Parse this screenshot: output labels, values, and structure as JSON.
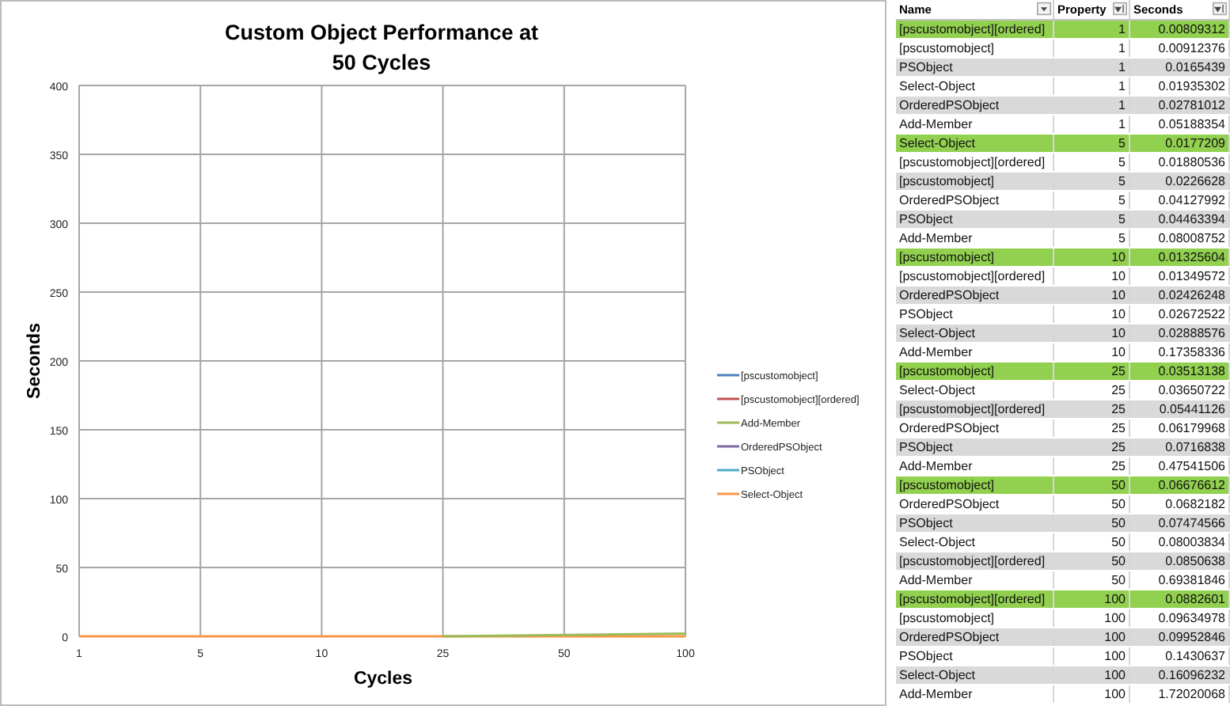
{
  "chart": {
    "chart_data": {
      "type": "line",
      "grid": true,
      "legend": true,
      "title": "Custom Object Performance at 50 Cycles",
      "xlabel": "Cycles",
      "ylabel": "Seconds",
      "categories": [
        "1",
        "5",
        "10",
        "25",
        "50",
        "100"
      ],
      "series": [
        {
          "name": "[pscustomobject]",
          "color": "#4f81bd",
          "values": [
            null,
            null,
            null,
            null,
            null,
            null
          ]
        },
        {
          "name": "[pscustomobject][ordered]",
          "color": "#c0504d",
          "values": [
            null,
            null,
            null,
            null,
            null,
            null
          ]
        },
        {
          "name": "Add-Member",
          "color": "#9bbb59",
          "values": [
            null,
            null,
            null,
            0,
            1,
            2
          ]
        },
        {
          "name": "OrderedPSObject",
          "color": "#8064a2",
          "values": [
            null,
            null,
            null,
            null,
            null,
            null
          ]
        },
        {
          "name": "PSObject",
          "color": "#4bacc6",
          "values": [
            null,
            null,
            null,
            null,
            null,
            null
          ]
        },
        {
          "name": "Select-Object",
          "color": "#f79646",
          "values": [
            0,
            0,
            0,
            0,
            0,
            0
          ]
        }
      ],
      "ylim": [
        0,
        400
      ],
      "yticks": [
        0,
        50,
        100,
        150,
        200,
        250,
        300,
        350,
        400
      ]
    }
  },
  "table": {
    "columns": [
      {
        "label": "Name",
        "kind": "filter"
      },
      {
        "label": "Property",
        "kind": "sort"
      },
      {
        "label": "Seconds",
        "kind": "sort"
      }
    ],
    "rows": [
      {
        "name": "[pscustomobject][ordered]",
        "property": "1",
        "seconds": "0.00809312",
        "highlighted": true
      },
      {
        "name": "[pscustomobject]",
        "property": "1",
        "seconds": "0.00912376",
        "highlighted": false
      },
      {
        "name": "PSObject",
        "property": "1",
        "seconds": "0.0165439",
        "highlighted": false
      },
      {
        "name": "Select-Object",
        "property": "1",
        "seconds": "0.01935302",
        "highlighted": false
      },
      {
        "name": "OrderedPSObject",
        "property": "1",
        "seconds": "0.02781012",
        "highlighted": false
      },
      {
        "name": "Add-Member",
        "property": "1",
        "seconds": "0.05188354",
        "highlighted": false
      },
      {
        "name": "Select-Object",
        "property": "5",
        "seconds": "0.0177209",
        "highlighted": true
      },
      {
        "name": "[pscustomobject][ordered]",
        "property": "5",
        "seconds": "0.01880536",
        "highlighted": false
      },
      {
        "name": "[pscustomobject]",
        "property": "5",
        "seconds": "0.0226628",
        "highlighted": false
      },
      {
        "name": "OrderedPSObject",
        "property": "5",
        "seconds": "0.04127992",
        "highlighted": false
      },
      {
        "name": "PSObject",
        "property": "5",
        "seconds": "0.04463394",
        "highlighted": false
      },
      {
        "name": "Add-Member",
        "property": "5",
        "seconds": "0.08008752",
        "highlighted": false
      },
      {
        "name": "[pscustomobject]",
        "property": "10",
        "seconds": "0.01325604",
        "highlighted": true
      },
      {
        "name": "[pscustomobject][ordered]",
        "property": "10",
        "seconds": "0.01349572",
        "highlighted": false
      },
      {
        "name": "OrderedPSObject",
        "property": "10",
        "seconds": "0.02426248",
        "highlighted": false
      },
      {
        "name": "PSObject",
        "property": "10",
        "seconds": "0.02672522",
        "highlighted": false
      },
      {
        "name": "Select-Object",
        "property": "10",
        "seconds": "0.02888576",
        "highlighted": false
      },
      {
        "name": "Add-Member",
        "property": "10",
        "seconds": "0.17358336",
        "highlighted": false
      },
      {
        "name": "[pscustomobject]",
        "property": "25",
        "seconds": "0.03513138",
        "highlighted": true
      },
      {
        "name": "Select-Object",
        "property": "25",
        "seconds": "0.03650722",
        "highlighted": false
      },
      {
        "name": "[pscustomobject][ordered]",
        "property": "25",
        "seconds": "0.05441126",
        "highlighted": false
      },
      {
        "name": "OrderedPSObject",
        "property": "25",
        "seconds": "0.06179968",
        "highlighted": false
      },
      {
        "name": "PSObject",
        "property": "25",
        "seconds": "0.0716838",
        "highlighted": false
      },
      {
        "name": "Add-Member",
        "property": "25",
        "seconds": "0.47541506",
        "highlighted": false
      },
      {
        "name": "[pscustomobject]",
        "property": "50",
        "seconds": "0.06676612",
        "highlighted": true
      },
      {
        "name": "OrderedPSObject",
        "property": "50",
        "seconds": "0.0682182",
        "highlighted": false
      },
      {
        "name": "PSObject",
        "property": "50",
        "seconds": "0.07474566",
        "highlighted": false
      },
      {
        "name": "Select-Object",
        "property": "50",
        "seconds": "0.08003834",
        "highlighted": false
      },
      {
        "name": "[pscustomobject][ordered]",
        "property": "50",
        "seconds": "0.0850638",
        "highlighted": false
      },
      {
        "name": "Add-Member",
        "property": "50",
        "seconds": "0.69381846",
        "highlighted": false
      },
      {
        "name": "[pscustomobject][ordered]",
        "property": "100",
        "seconds": "0.0882601",
        "highlighted": true
      },
      {
        "name": "[pscustomobject]",
        "property": "100",
        "seconds": "0.09634978",
        "highlighted": false
      },
      {
        "name": "OrderedPSObject",
        "property": "100",
        "seconds": "0.09952846",
        "highlighted": false
      },
      {
        "name": "PSObject",
        "property": "100",
        "seconds": "0.1430637",
        "highlighted": false
      },
      {
        "name": "Select-Object",
        "property": "100",
        "seconds": "0.16096232",
        "highlighted": false
      },
      {
        "name": "Add-Member",
        "property": "100",
        "seconds": "1.72020068",
        "highlighted": false
      }
    ]
  }
}
